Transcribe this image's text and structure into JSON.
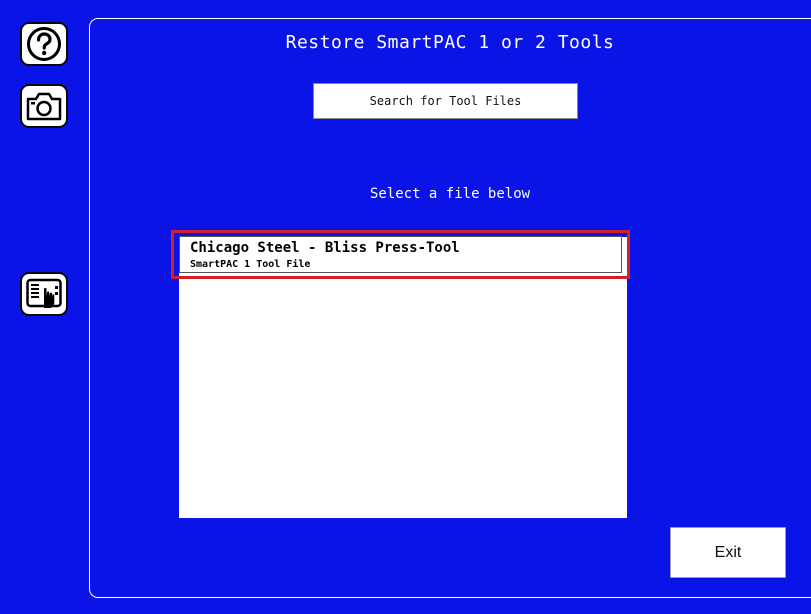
{
  "page": {
    "title": "Restore SmartPAC 1 or 2 Tools",
    "background_color": "#0a14e6"
  },
  "sidebar": {
    "buttons": [
      {
        "icon": "question-circle-icon"
      },
      {
        "icon": "camera-icon"
      },
      {
        "icon": "touchscreen-hand-icon"
      }
    ]
  },
  "search": {
    "label": "Search for Tool Files"
  },
  "file_list": {
    "prompt": "Select a file below",
    "highlight_color": "#d0202e",
    "items": [
      {
        "name": "Chicago Steel - Bliss Press-Tool",
        "type": "SmartPAC 1 Tool File",
        "selected": true
      }
    ]
  },
  "footer": {
    "exit_label": "Exit"
  }
}
